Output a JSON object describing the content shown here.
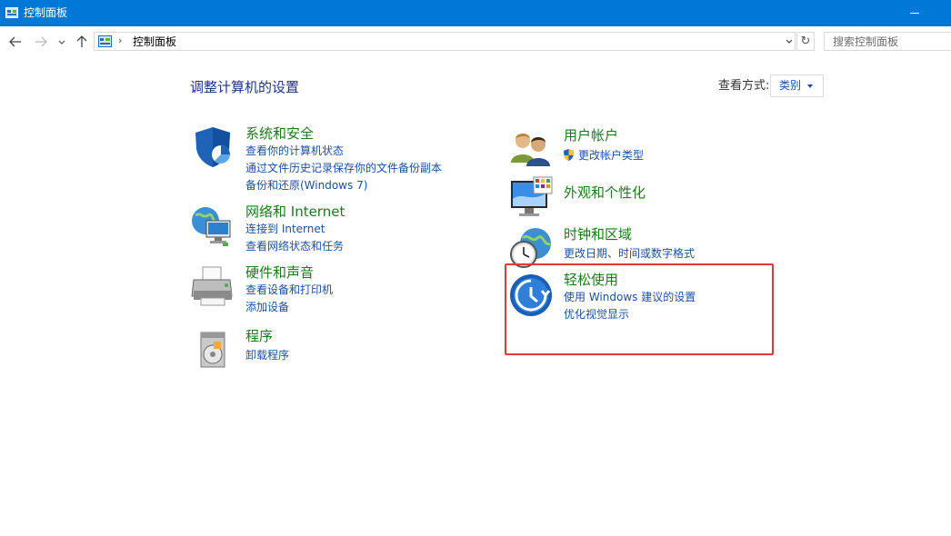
{
  "window": {
    "title": "控制面板"
  },
  "address_bar": {
    "path": "控制面板",
    "search_placeholder": "搜索控制面板"
  },
  "heading": "调整计算机的设置",
  "view_by": {
    "label": "查看方式:",
    "value": "类别"
  },
  "categories_left": [
    {
      "icon": "shield-icon",
      "title": "系统和安全",
      "links": [
        "查看你的计算机状态",
        "通过文件历史记录保存你的文件备份副本",
        "备份和还原(Windows 7)"
      ]
    },
    {
      "icon": "network-globe-icon",
      "title": "网络和 Internet",
      "links": [
        "连接到 Internet",
        "查看网络状态和任务"
      ]
    },
    {
      "icon": "printer-icon",
      "title": "硬件和声音",
      "links": [
        "查看设备和打印机",
        "添加设备"
      ]
    },
    {
      "icon": "programs-icon",
      "title": "程序",
      "links": [
        "卸载程序"
      ]
    }
  ],
  "categories_right": [
    {
      "icon": "users-icon",
      "title": "用户帐户",
      "links": [
        "更改帐户类型"
      ]
    },
    {
      "icon": "appearance-icon",
      "title": "外观和个性化",
      "links": []
    },
    {
      "icon": "clock-globe-icon",
      "title": "时钟和区域",
      "links": [
        "更改日期、时间或数字格式"
      ]
    },
    {
      "icon": "ease-of-access-icon",
      "title": "轻松使用",
      "links": [
        "使用 Windows 建议的设置",
        "优化视觉显示"
      ]
    }
  ],
  "colors": {
    "title_bar": "#0078d7",
    "category_title": "#1a7a1a",
    "link": "#1e50a0",
    "highlight": "#e53935"
  }
}
